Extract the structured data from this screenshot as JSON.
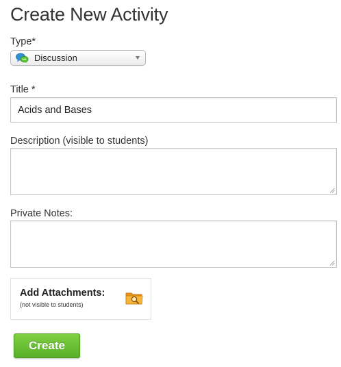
{
  "page": {
    "title": "Create New Activity"
  },
  "form": {
    "type": {
      "label": "Type*",
      "selected": "Discussion",
      "icon": "discussion-icon"
    },
    "title": {
      "label": "Title *",
      "value": "Acids and Bases"
    },
    "description": {
      "label": "Description (visible to students)",
      "value": ""
    },
    "private_notes": {
      "label": "Private Notes:",
      "value": ""
    },
    "attachments": {
      "title": "Add Attachments:",
      "subtitle": "(not visible to students)",
      "icon": "folder-search-icon"
    },
    "submit_label": "Create"
  },
  "colors": {
    "create_button": "#5cb82c",
    "accent_orange": "#f0a020"
  }
}
